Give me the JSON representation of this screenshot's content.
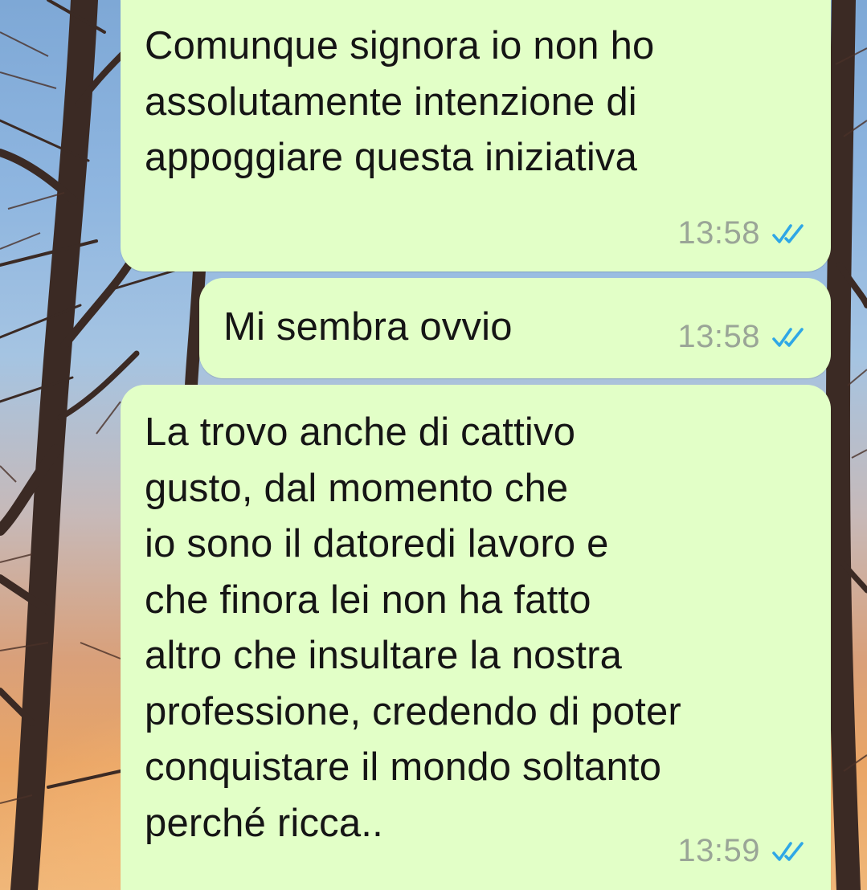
{
  "chat": {
    "messages": [
      {
        "text": "Comunque signora io non ho\nassolutamente intenzione di\nappoggiare questa iniziativa",
        "time": "13:58",
        "status_icon": "double-check-read-icon"
      },
      {
        "text": "Mi sembra ovvio",
        "time": "13:58",
        "status_icon": "double-check-read-icon"
      },
      {
        "text": "La trovo anche di cattivo\ngusto, dal momento che\nio sono il datoredi lavoro e\nche finora lei non ha fatto\naltro che insultare la nostra\nprofessione, credendo di poter\nconquistare il mondo soltanto\nperché ricca..",
        "time": "13:59",
        "status_icon": "double-check-read-icon"
      }
    ]
  },
  "colors": {
    "bubble_background": "#e2ffc7",
    "timestamp": "#9aa597",
    "read_ticks": "#2fa7e6"
  }
}
